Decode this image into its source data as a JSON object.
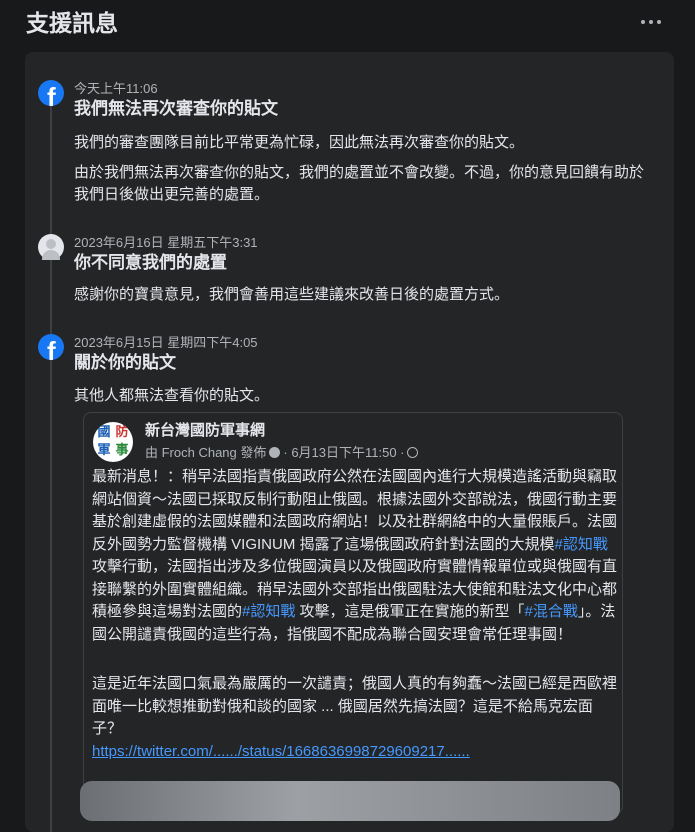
{
  "header": {
    "title": "支援訊息"
  },
  "entries": [
    {
      "timestamp": "今天上午11:06",
      "title": "我們無法再次審查你的貼文",
      "paragraphs": [
        "我們的審查團隊目前比平常更為忙碌，因此無法再次審查你的貼文。",
        "由於我們無法再次審查你的貼文，我們的處置並不會改變。不過，你的意見回饋有助於我們日後做出更完善的處置。"
      ]
    },
    {
      "timestamp": "2023年6月16日 星期五下午3:31",
      "title": "你不同意我們的處置",
      "paragraphs": [
        "感謝你的寶貴意見，我們會善用這些建議來改善日後的處置方式。"
      ]
    },
    {
      "timestamp": "2023年6月15日 星期四下午4:05",
      "title": "關於你的貼文",
      "paragraphs": [
        "其他人都無法查看你的貼文。"
      ]
    }
  ],
  "post": {
    "avatar_chars": [
      "國",
      "防",
      "軍",
      "事"
    ],
    "page_name": "新台灣國防軍事網",
    "byline_author": "由 Froch Chang 發佈",
    "byline_date": "· 6月13日下午11:50 ·",
    "body_1a": "最新消息！：稍早法國指責俄國政府公然在法國國內進行大規模造謠活動與竊取網站個資～法國已採取反制行動阻止俄國。根據法國外交部說法，俄國行動主要基於創建虛假的法國媒體和法國政府網站！以及社群網絡中的大量假賬戶。法國反外國勢力監督機構 VIGINUM 揭露了這場俄國政府針對法國的大規模",
    "tag_1": "#認知戰",
    "body_1b": " 攻擊行動，法國指出涉及多位俄國演員以及俄國政府實體情報單位或與俄國有直接聯繫的外圍實體組織。稍早法國外交部指出俄國駐法大使館和駐法文化中心都積極參與這場對法國的",
    "tag_2": "#認知戰",
    "body_1c": " 攻擊，這是俄軍正在實施的新型「",
    "tag_3": "#混合戰",
    "body_1d": "」。法國公開譴責俄國的這些行為，指俄國不配成為聯合國安理會常任理事國！",
    "body_2": "這是近年法國口氣最為嚴厲的一次譴責；俄國人真的有夠蠢～法國已經是西歐裡面唯一比較想推動對俄和談的國家 ... 俄國居然先搞法國？這是不給馬克宏面子？",
    "link": "https://twitter.com/....../status/1668636998729609217......"
  },
  "colors": {
    "accent": "#1877f2",
    "link": "#4599ff",
    "background": "#18191a",
    "panel": "#242526"
  },
  "icons": [
    "more-options-icon",
    "facebook-icon",
    "user-avatar-icon",
    "privacy-icon",
    "globe-icon"
  ]
}
